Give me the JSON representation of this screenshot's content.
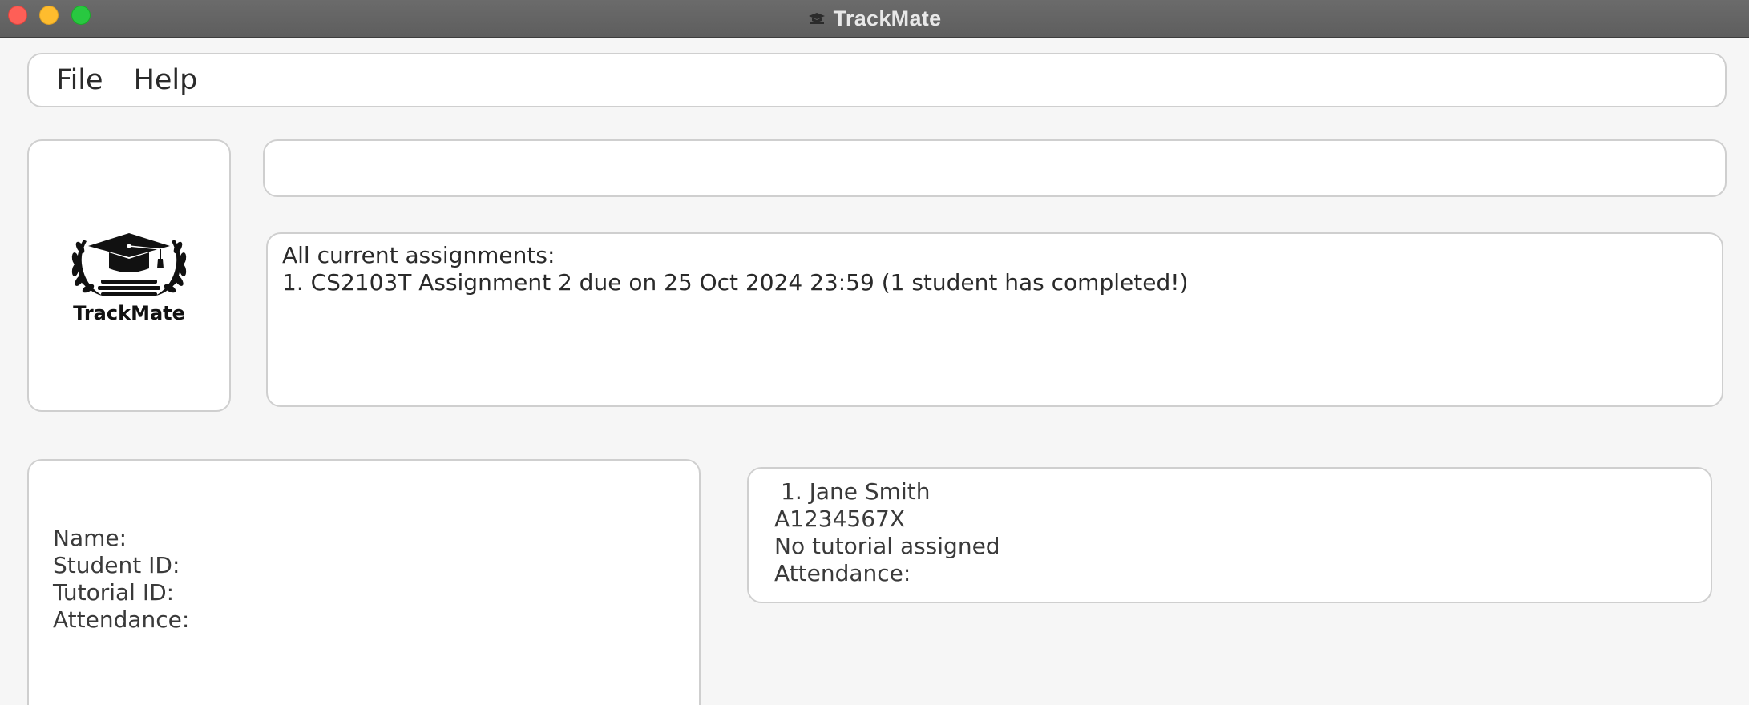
{
  "window": {
    "title": "TrackMate"
  },
  "menu": {
    "items": [
      "File",
      "Help"
    ]
  },
  "logo": {
    "text": "TrackMate"
  },
  "command": {
    "value": "",
    "placeholder": ""
  },
  "result": {
    "lines": [
      "All current assignments:",
      "1. CS2103T Assignment 2 due on 25 Oct 2024 23:59 (1 student has completed!)"
    ]
  },
  "detail": {
    "name_label": "Name:",
    "student_id_label": "Student ID:",
    "tutorial_id_label": "Tutorial ID:",
    "attendance_label": "Attendance:"
  },
  "student_list": [
    {
      "index_name": "1. Jane Smith",
      "student_id": "A1234567X",
      "tutorial": "No tutorial assigned",
      "attendance_label": "Attendance:"
    }
  ],
  "colors": {
    "close": "#fe5f57",
    "minimize": "#febc2e",
    "zoom": "#28c840",
    "titlebar": "#636363",
    "background": "#f6f6f6",
    "panel_border": "#cfcfcf"
  },
  "icons": {
    "title": "graduation-cap-icon",
    "logo": "graduation-cap-laurel-logo"
  }
}
